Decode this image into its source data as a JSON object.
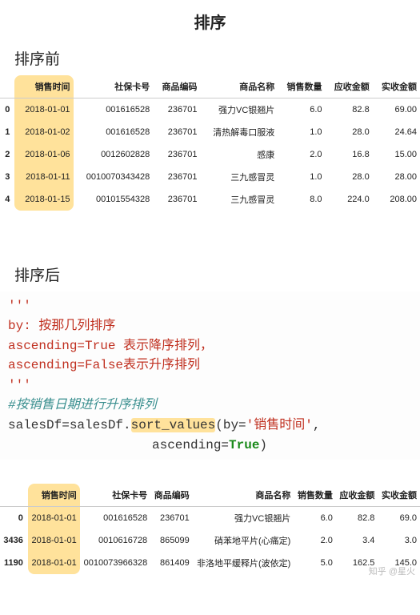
{
  "title": "排序",
  "section_before": "排序前",
  "section_after": "排序后",
  "table1": {
    "headers": [
      "销售时间",
      "社保卡号",
      "商品编码",
      "商品名称",
      "销售数量",
      "应收金额",
      "实收金额"
    ],
    "rows": [
      {
        "idx": "0",
        "time": "2018-01-01",
        "card": "001616528",
        "code": "236701",
        "name": "强力VC银翘片",
        "qty": "6.0",
        "due": "82.8",
        "paid": "69.00"
      },
      {
        "idx": "1",
        "time": "2018-01-02",
        "card": "001616528",
        "code": "236701",
        "name": "清热解毒口服液",
        "qty": "1.0",
        "due": "28.0",
        "paid": "24.64"
      },
      {
        "idx": "2",
        "time": "2018-01-06",
        "card": "0012602828",
        "code": "236701",
        "name": "感康",
        "qty": "2.0",
        "due": "16.8",
        "paid": "15.00"
      },
      {
        "idx": "3",
        "time": "2018-01-11",
        "card": "0010070343428",
        "code": "236701",
        "name": "三九感冒灵",
        "qty": "1.0",
        "due": "28.0",
        "paid": "28.00"
      },
      {
        "idx": "4",
        "time": "2018-01-15",
        "card": "00101554328",
        "code": "236701",
        "name": "三九感冒灵",
        "qty": "8.0",
        "due": "224.0",
        "paid": "208.00"
      }
    ]
  },
  "code": {
    "q1": "'''",
    "l1a": "by: 按那几列排序",
    "l2a": "ascending=True ",
    "l2b": "表示降序排列，",
    "l3a": "ascending=False",
    "l3b": "表示升序排列",
    "q2": "'''",
    "cmt": "#按销售日期进行升序排列",
    "l4a": "salesDf=salesDf.",
    "l4b": "sort_values",
    "l4c": "(by=",
    "l4d": "'销售时间'",
    "l4e": ",",
    "l5a": "ascending=",
    "l5b": "True",
    "l5c": ")"
  },
  "table2": {
    "headers": [
      "销售时间",
      "社保卡号",
      "商品编码",
      "商品名称",
      "销售数量",
      "应收金额",
      "实收金额"
    ],
    "rows": [
      {
        "idx": "0",
        "time": "2018-01-01",
        "card": "001616528",
        "code": "236701",
        "name": "强力VC银翘片",
        "qty": "6.0",
        "due": "82.8",
        "paid": "69.0"
      },
      {
        "idx": "3436",
        "time": "2018-01-01",
        "card": "0010616728",
        "code": "865099",
        "name": "硝苯地平片(心痛定)",
        "qty": "2.0",
        "due": "3.4",
        "paid": "3.0"
      },
      {
        "idx": "1190",
        "time": "2018-01-01",
        "card": "0010073966328",
        "code": "861409",
        "name": "非洛地平缓释片(波依定)",
        "qty": "5.0",
        "due": "162.5",
        "paid": "145.0"
      }
    ]
  },
  "watermark": "知乎 @星火"
}
